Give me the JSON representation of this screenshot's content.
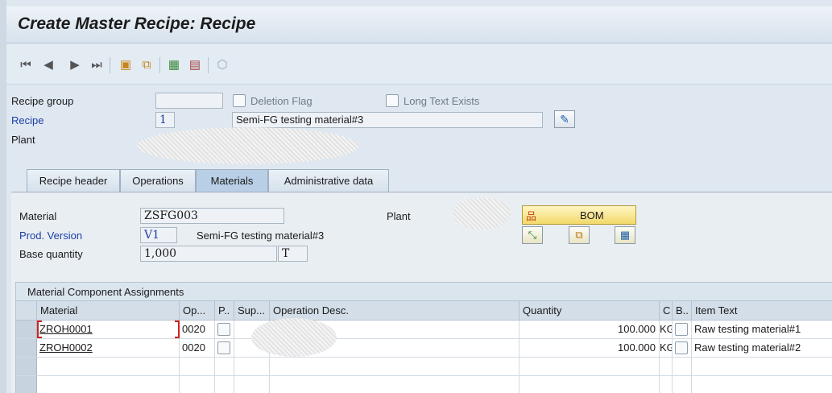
{
  "window": {
    "title": "Create Master Recipe: Recipe"
  },
  "toolbar": {
    "icons": [
      "first-page-icon",
      "previous-page-icon",
      "next-page-icon",
      "last-page-icon",
      "header-icon",
      "operations-icon",
      "structure-icon",
      "print-icon",
      "display-icon"
    ]
  },
  "header": {
    "recipe_group_label": "Recipe group",
    "recipe_group_value": "",
    "deletion_flag_label": "Deletion Flag",
    "long_text_label": "Long Text Exists",
    "recipe_label": "Recipe",
    "recipe_value": "1",
    "recipe_desc": "Semi-FG testing material#3",
    "plant_label": "Plant"
  },
  "tabs": [
    {
      "label": "Recipe header"
    },
    {
      "label": "Operations"
    },
    {
      "label": "Materials"
    },
    {
      "label": "Administrative data"
    }
  ],
  "materials": {
    "material_label": "Material",
    "material_value": "ZSFG003",
    "plant_label": "Plant",
    "prod_version_label": "Prod. Version",
    "prod_version_value": "V1",
    "prod_version_desc": "Semi-FG testing material#3",
    "base_qty_label": "Base quantity",
    "base_qty_value": "1,000",
    "base_qty_unit": "T",
    "bom_label": "BOM"
  },
  "grid": {
    "title": "Material Component Assignments",
    "columns": [
      "Material",
      "Op...",
      "P..",
      "Sup...",
      "Operation Desc.",
      "Quantity",
      "C",
      "B..",
      "Item Text"
    ],
    "rows": [
      {
        "material": "ZROH0001",
        "op": "0020",
        "quantity": "100.000",
        "unit": "KG",
        "item_text": "Raw testing material#1"
      },
      {
        "material": "ZROH0002",
        "op": "0020",
        "quantity": "100.000",
        "unit": "KG",
        "item_text": "Raw testing material#2"
      }
    ]
  },
  "colors": {
    "link": "#1d3ea6",
    "bom_button": "#f2d96a",
    "selected_tab": "#b9cfe6"
  }
}
